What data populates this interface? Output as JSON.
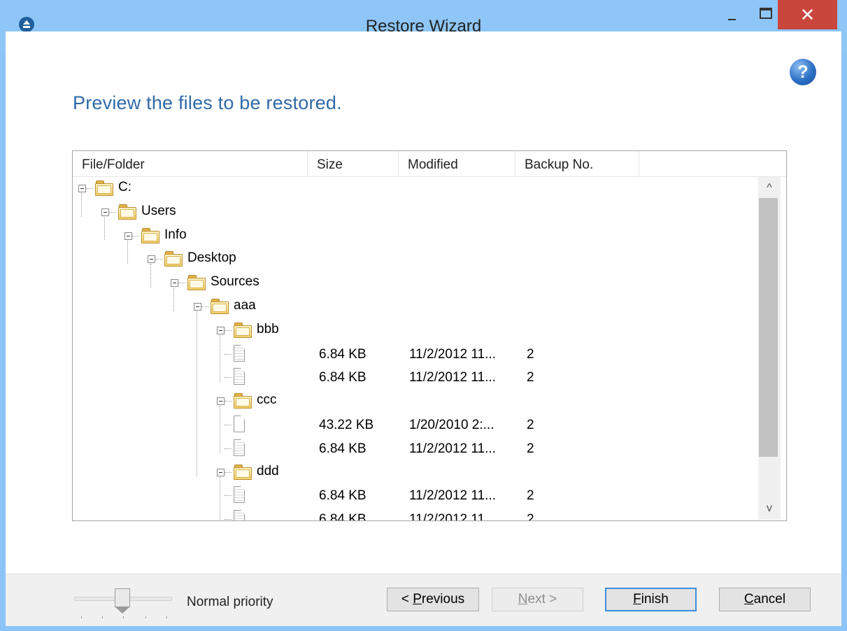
{
  "window": {
    "title": "Restore Wizard",
    "close_glyph": "✕"
  },
  "help_glyph": "?",
  "heading": "Preview the files to be restored.",
  "columns": [
    "File/Folder",
    "Size",
    "Modified",
    "Backup No."
  ],
  "tree": [
    {
      "type": "folder",
      "name": "C:"
    },
    {
      "type": "folder",
      "name": "Users"
    },
    {
      "type": "folder",
      "name": "Info"
    },
    {
      "type": "folder",
      "name": "Desktop"
    },
    {
      "type": "folder",
      "name": "Sources"
    },
    {
      "type": "folder",
      "name": "aaa"
    },
    {
      "type": "folder",
      "name": "bbb"
    },
    {
      "type": "file",
      "size": "6.84 KB",
      "modified": "11/2/2012 11...",
      "backup": "2"
    },
    {
      "type": "file",
      "size": "6.84 KB",
      "modified": "11/2/2012 11...",
      "backup": "2"
    },
    {
      "type": "folder",
      "name": "ccc"
    },
    {
      "type": "file",
      "size": "43.22 KB",
      "modified": "1/20/2010 2:...",
      "backup": "2"
    },
    {
      "type": "file",
      "size": "6.84 KB",
      "modified": "11/2/2012 11...",
      "backup": "2"
    },
    {
      "type": "folder",
      "name": "ddd"
    },
    {
      "type": "file",
      "size": "6.84 KB",
      "modified": "11/2/2012 11...",
      "backup": "2"
    },
    {
      "type": "file",
      "size": "6.84 KB",
      "modified": "11/2/2012 11...",
      "backup": "2"
    }
  ],
  "scroll": {
    "up": "^",
    "down": "v"
  },
  "footer": {
    "priority_label": "Normal priority",
    "priority_level": 0.5,
    "previous": {
      "prefix": "< ",
      "mnemonic": "P",
      "rest": "revious"
    },
    "next": {
      "mnemonic": "N",
      "rest": "ext >"
    },
    "finish": {
      "mnemonic": "F",
      "rest": "inish"
    },
    "cancel": {
      "mnemonic": "C",
      "rest": "ancel"
    }
  }
}
